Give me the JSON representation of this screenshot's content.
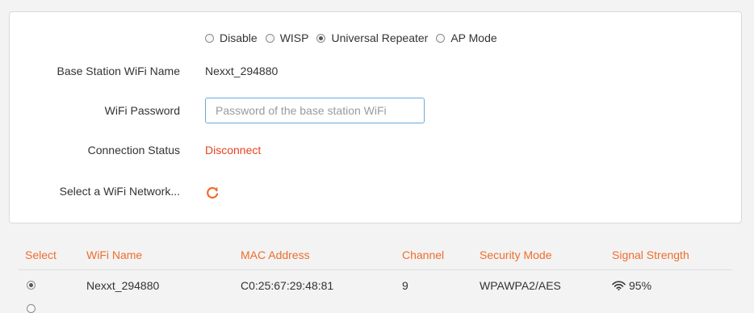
{
  "mode": {
    "options": [
      "Disable",
      "WISP",
      "Universal Repeater",
      "AP Mode"
    ],
    "selected": "Universal Repeater"
  },
  "form": {
    "base_station_label": "Base Station WiFi Name",
    "base_station_value": "Nexxt_294880",
    "password_label": "WiFi Password",
    "password_placeholder": "Password of the base station WiFi",
    "password_value": "",
    "connection_label": "Connection Status",
    "connection_value": "Disconnect",
    "connection_color": "#e8431f",
    "select_network_label": "Select a WiFi Network..."
  },
  "table": {
    "headers": [
      "Select",
      "WiFi Name",
      "MAC Address",
      "Channel",
      "Security Mode",
      "Signal Strength"
    ],
    "header_color": "#ee6e2d",
    "rows": [
      {
        "selected": true,
        "wifi_name": "Nexxt_294880",
        "mac": "C0:25:67:29:48:81",
        "channel": "9",
        "security": "WPAWPA2/AES",
        "signal": "95%"
      }
    ]
  },
  "icons": {
    "refresh": "refresh-icon",
    "signal": "wifi-signal-icon"
  }
}
